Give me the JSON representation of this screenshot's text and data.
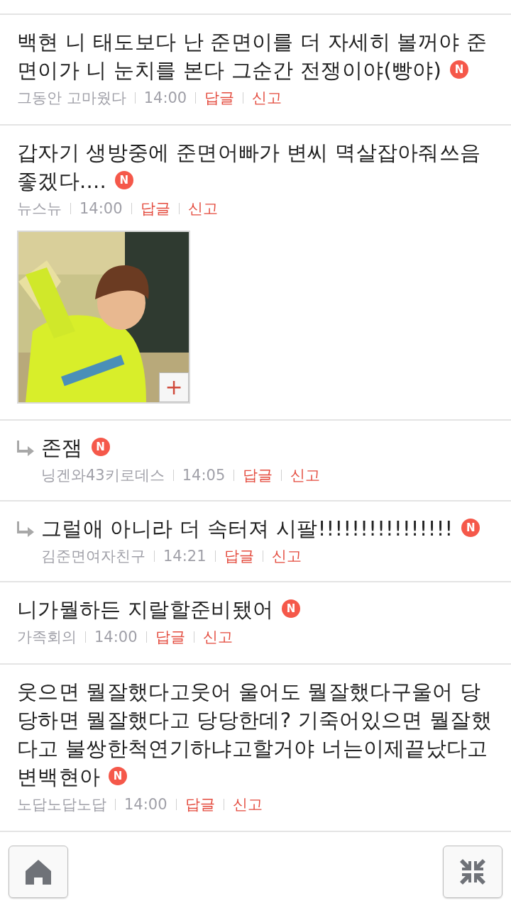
{
  "comments": [
    {
      "kind": "comment",
      "text": "백현 니 태도보다 난 준면이를 더 자세히 볼꺼야 준면이가 니 눈치를 본다 그순간 전쟁이야(빵야)",
      "badge": "N",
      "author": "그동안 고마웠다",
      "time": "14:00",
      "reply_label": "답글",
      "report_label": "신고"
    },
    {
      "kind": "comment",
      "text": "갑자기 생방중에 준면어빠가 변씨 멱살잡아줘쓰음 좋겠다....",
      "badge": "N",
      "author": "뉴스뉴",
      "time": "14:00",
      "reply_label": "답글",
      "report_label": "신고",
      "image": {
        "kind": "picture",
        "expand": "+"
      }
    },
    {
      "kind": "reply",
      "text": "존잼",
      "badge": "N",
      "author": "닝겐와43키로데스",
      "time": "14:05",
      "reply_label": "답글",
      "report_label": "신고"
    },
    {
      "kind": "reply",
      "text": "그럴애 아니라 더 속터져 시팔!!!!!!!!!!!!!!!!",
      "badge": "N",
      "author": "김준면여자친구",
      "time": "14:21",
      "reply_label": "답글",
      "report_label": "신고"
    },
    {
      "kind": "comment",
      "text": "니가뭘하든 지랄할준비됐어",
      "badge": "N",
      "author": "가족회의",
      "time": "14:00",
      "reply_label": "답글",
      "report_label": "신고"
    },
    {
      "kind": "comment",
      "text": "웃으면 뭘잘했다고웃어 울어도 뭘잘했다구울어 당당하면 뭘잘했다고 당당한데? 기죽어있으면 뭘잘했다고 불쌍한척연기하냐고할거야 너는이제끝났다고 변백현아",
      "badge": "N",
      "author": "노답노답노답",
      "time": "14:00",
      "reply_label": "답글",
      "report_label": "신고"
    }
  ],
  "floating_buttons": [
    {
      "kind": "home"
    },
    {
      "kind": "collapse"
    }
  ]
}
